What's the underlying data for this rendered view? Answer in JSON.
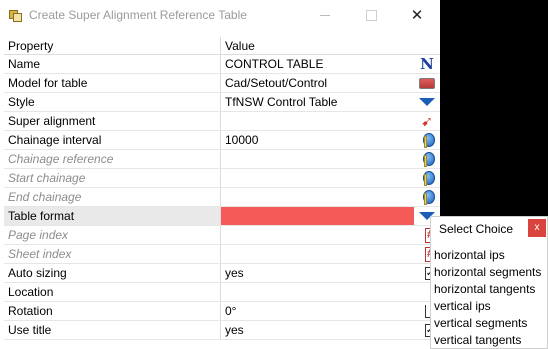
{
  "window": {
    "title": "Create Super Alignment Reference Table",
    "close_glyph": "✕"
  },
  "grid": {
    "header": {
      "col_property": "Property",
      "col_value": "Value"
    },
    "rows": [
      {
        "label": "Name",
        "value": "CONTROL TABLE",
        "icon": "n-icon",
        "disabled": false,
        "selected": false
      },
      {
        "label": "Model for table",
        "value": "Cad/Setout/Control",
        "icon": "model-icon",
        "disabled": false,
        "selected": false
      },
      {
        "label": "Style",
        "value": "TfNSW Control Table",
        "icon": "dropdown-icon",
        "disabled": false,
        "selected": false
      },
      {
        "label": "Super alignment",
        "value": "",
        "icon": "pick-icon",
        "disabled": false,
        "selected": false
      },
      {
        "label": "Chainage interval",
        "value": "10000",
        "icon": "globe-icon",
        "disabled": false,
        "selected": false
      },
      {
        "label": "Chainage reference",
        "value": "",
        "icon": "globe-icon",
        "disabled": true,
        "selected": false
      },
      {
        "label": "Start chainage",
        "value": "",
        "icon": "globe-icon",
        "disabled": true,
        "selected": false
      },
      {
        "label": "End chainage",
        "value": "",
        "icon": "globe-icon",
        "disabled": true,
        "selected": false
      },
      {
        "label": "Table format",
        "value": "",
        "icon": "dropdown-icon",
        "disabled": false,
        "selected": true
      },
      {
        "label": "Page index",
        "value": "",
        "icon": "hash-icon",
        "disabled": true,
        "selected": false
      },
      {
        "label": "Sheet index",
        "value": "",
        "icon": "hash-icon",
        "disabled": true,
        "selected": false
      },
      {
        "label": "Auto sizing",
        "value": "yes",
        "icon": "checkbox-icon",
        "disabled": false,
        "selected": false
      },
      {
        "label": "Location",
        "value": "",
        "icon": "none",
        "disabled": false,
        "selected": false
      },
      {
        "label": "Rotation",
        "value": "0°",
        "icon": "angle-icon",
        "disabled": false,
        "selected": false
      },
      {
        "label": "Use title",
        "value": "yes",
        "icon": "checkbox-icon",
        "disabled": false,
        "selected": false
      }
    ]
  },
  "popup": {
    "title": "Select Choice",
    "close_glyph": "x",
    "choices": [
      "horizontal ips",
      "horizontal segments",
      "horizontal tangents",
      "vertical ips",
      "vertical segments",
      "vertical tangents"
    ]
  },
  "colors": {
    "selected_value": "#f35a58",
    "close_button": "#d9453e"
  }
}
